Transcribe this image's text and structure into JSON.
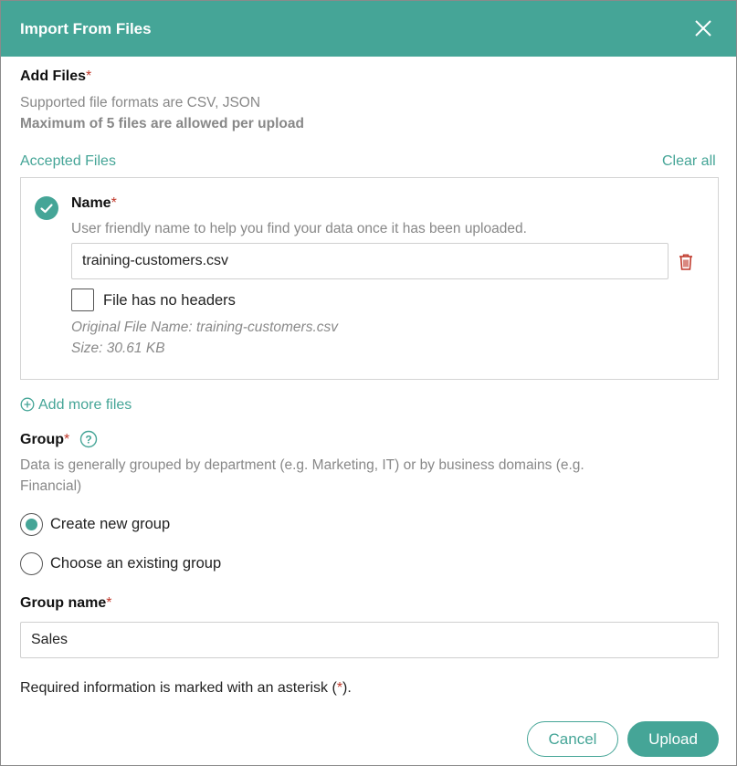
{
  "dialog": {
    "title": "Import From Files"
  },
  "add_files": {
    "label": "Add Files",
    "required_mark": "*",
    "formats_text": "Supported file formats are CSV, JSON",
    "max_text": "Maximum of 5 files are allowed per upload",
    "accepted_label": "Accepted Files",
    "clear_all": "Clear all"
  },
  "file_card": {
    "name_label": "Name",
    "required_mark": "*",
    "name_help": "User friendly name to help you find your data once it has been uploaded.",
    "name_value": "training-customers.csv",
    "no_headers_label": "File has no headers",
    "no_headers_checked": false,
    "original_name": "Original File Name: training-customers.csv",
    "size": "Size: 30.61 KB",
    "status_color": "#45a597",
    "delete_color": "#c0392b"
  },
  "add_more": {
    "label": "Add more files"
  },
  "group": {
    "label": "Group",
    "required_mark": "*",
    "help_line1": "Data is generally grouped by department (e.g. Marketing, IT) or by business domains (e.g.",
    "help_line2": "Financial)",
    "options": [
      {
        "label": "Create new group",
        "selected": true
      },
      {
        "label": "Choose an existing group",
        "selected": false
      }
    ]
  },
  "group_name": {
    "label": "Group name",
    "required_mark": "*",
    "value": "Sales"
  },
  "footer": {
    "note_prefix": "Required information is marked with an asterisk (",
    "note_mark": "*",
    "note_suffix": ").",
    "cancel_label": "Cancel",
    "upload_label": "Upload"
  },
  "colors": {
    "accent": "#45a597",
    "required": "#c0392b"
  }
}
